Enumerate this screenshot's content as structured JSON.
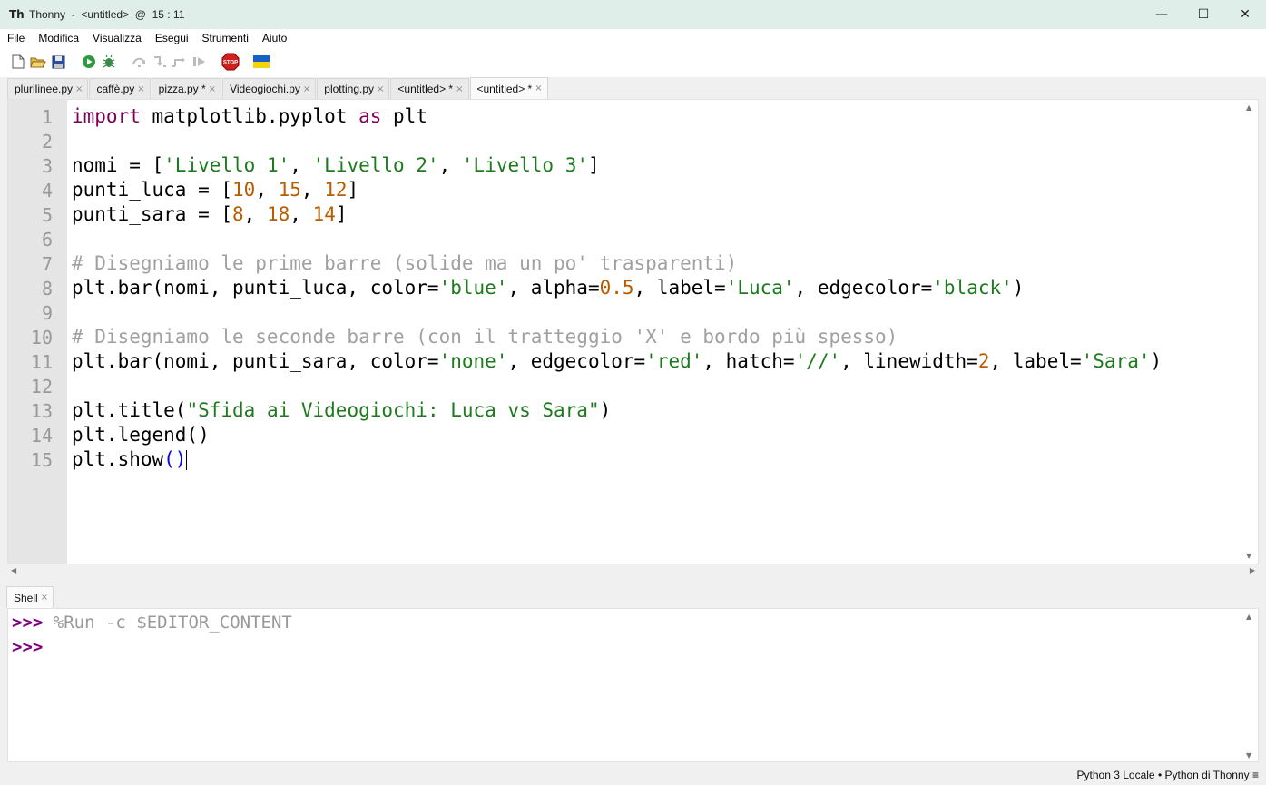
{
  "window": {
    "app_icon": "Th",
    "title": "Thonny  -  <untitled>  @  15 : 11",
    "minimize": "—",
    "maximize": "☐",
    "close": "✕"
  },
  "menu": [
    "File",
    "Modifica",
    "Visualizza",
    "Esegui",
    "Strumenti",
    "Aiuto"
  ],
  "toolbar": {
    "icons": [
      "new-file-icon",
      "open-file-icon",
      "save-icon",
      "run-icon",
      "debug-icon",
      "step-over-icon",
      "step-into-icon",
      "step-out-icon",
      "resume-icon",
      "stop-icon",
      "ukraine-flag-icon"
    ],
    "stop_label": "STOP"
  },
  "tabs": [
    {
      "label": "plurilinee.py",
      "close": "×"
    },
    {
      "label": "caffè.py",
      "close": "×"
    },
    {
      "label": "pizza.py *",
      "close": "×"
    },
    {
      "label": "Videogiochi.py",
      "close": "×"
    },
    {
      "label": "plotting.py",
      "close": "×"
    },
    {
      "label": "<untitled> *",
      "close": "×"
    },
    {
      "label": "<untitled> *",
      "close": "×"
    }
  ],
  "editor": {
    "line_numbers": [
      "1",
      "2",
      "3",
      "4",
      "5",
      "6",
      "7",
      "8",
      "9",
      "10",
      "11",
      "12",
      "13",
      "14",
      "15"
    ],
    "code": {
      "l1_kw1": "import",
      "l1_mid": " matplotlib.pyplot ",
      "l1_kw2": "as",
      "l1_end": " plt",
      "l3_a": "nomi = [",
      "l3_s1": "'Livello 1'",
      "l3_c1": ", ",
      "l3_s2": "'Livello 2'",
      "l3_c2": ", ",
      "l3_s3": "'Livello 3'",
      "l3_end": "]",
      "l4_a": "punti_luca = [",
      "l4_n1": "10",
      "l4_c1": ", ",
      "l4_n2": "15",
      "l4_c2": ", ",
      "l4_n3": "12",
      "l4_end": "]",
      "l5_a": "punti_sara = [",
      "l5_n1": "8",
      "l5_c1": ", ",
      "l5_n2": "18",
      "l5_c2": ", ",
      "l5_n3": "14",
      "l5_end": "]",
      "l7_cmt": "# Disegniamo le prime barre (solide ma un po' trasparenti)",
      "l8_a": "plt.bar(nomi, punti_luca, color=",
      "l8_s1": "'blue'",
      "l8_b": ", alpha=",
      "l8_n1": "0.5",
      "l8_c": ", label=",
      "l8_s2": "'Luca'",
      "l8_d": ", edgecolor=",
      "l8_s3": "'black'",
      "l8_end": ")",
      "l10_cmt": "# Disegniamo le seconde barre (con il tratteggio 'X' e bordo più spesso)",
      "l11_a": "plt.bar(nomi, punti_sara, color=",
      "l11_s1": "'none'",
      "l11_b": ", edgecolor=",
      "l11_s2": "'red'",
      "l11_c": ", hatch=",
      "l11_s3": "'//'",
      "l11_d": ", linewidth=",
      "l11_n1": "2",
      "l11_e": ", label=",
      "l11_s4": "'Sara'",
      "l11_end": ")",
      "l13_a": "plt.title(",
      "l13_s1": "\"Sfida ai Videogiochi: Luca vs Sara\"",
      "l13_end": ")",
      "l14": "plt.legend()",
      "l15_a": "plt.show",
      "l15_p": "()"
    }
  },
  "shell": {
    "tab_label": "Shell",
    "tab_close": "×",
    "prompt": ">>>",
    "command": " %Run -c $EDITOR_CONTENT"
  },
  "status": {
    "text": "Python 3 Locale  •  Python di Thonny  ≡"
  },
  "colors": {
    "keyword": "#7f0055",
    "string": "#1d7a1d",
    "number": "#b85c00",
    "comment": "#a0a0a0",
    "prompt": "#7f007f"
  }
}
